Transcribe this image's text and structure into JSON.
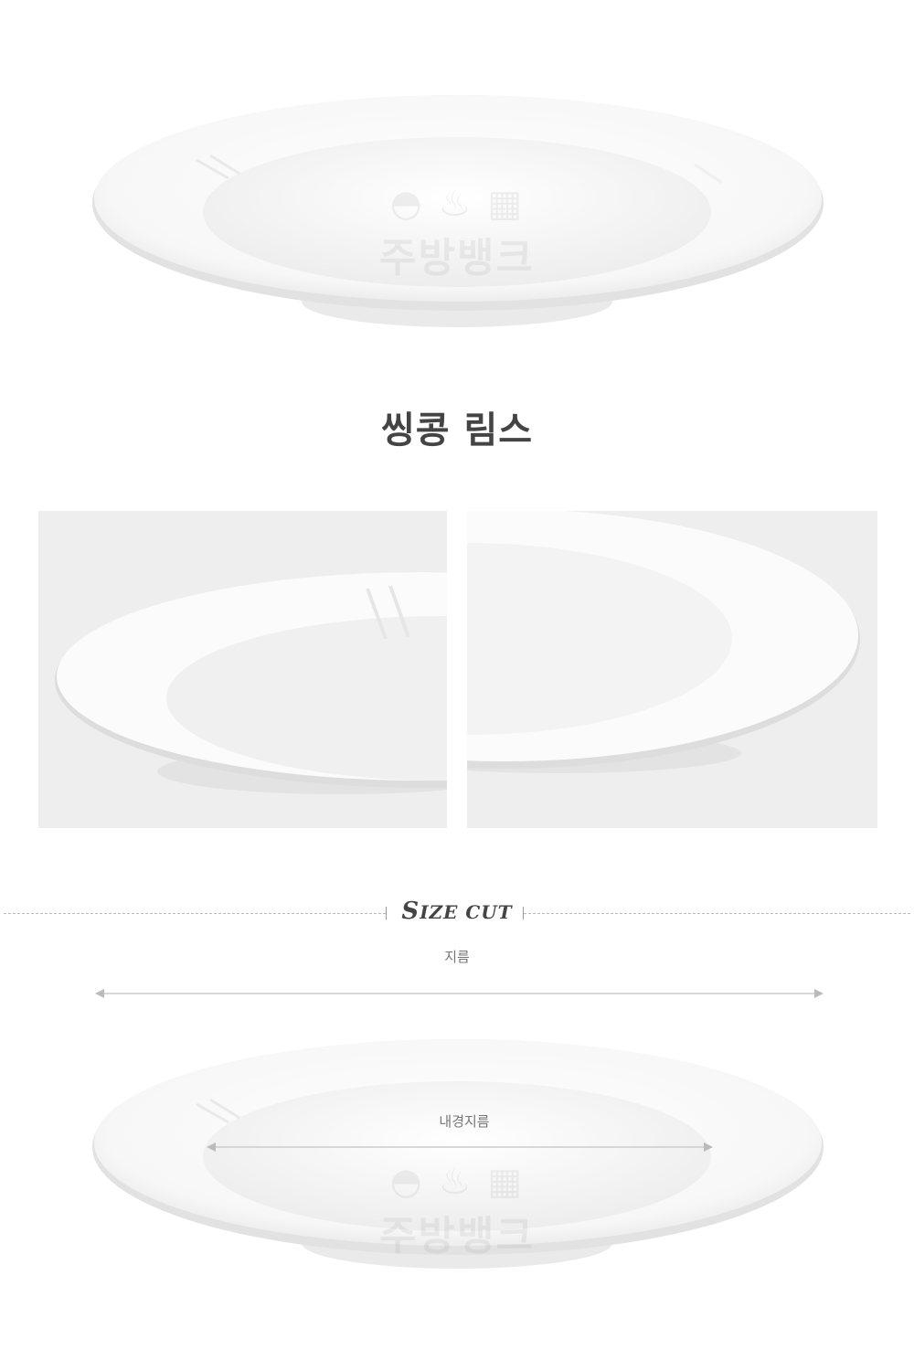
{
  "product": {
    "name": "씽콩 림스"
  },
  "watermark": {
    "brand_text": "주방뱅크"
  },
  "size_section": {
    "heading_initial": "S",
    "heading_rest": "IZE CUT",
    "diameter_label": "지름",
    "inner_diameter_label": "내경지름"
  },
  "colors": {
    "background": "#ffffff",
    "detail_panel": "#eeeeee",
    "title_text": "#444444",
    "dimension_arrow": "#cccccc"
  }
}
